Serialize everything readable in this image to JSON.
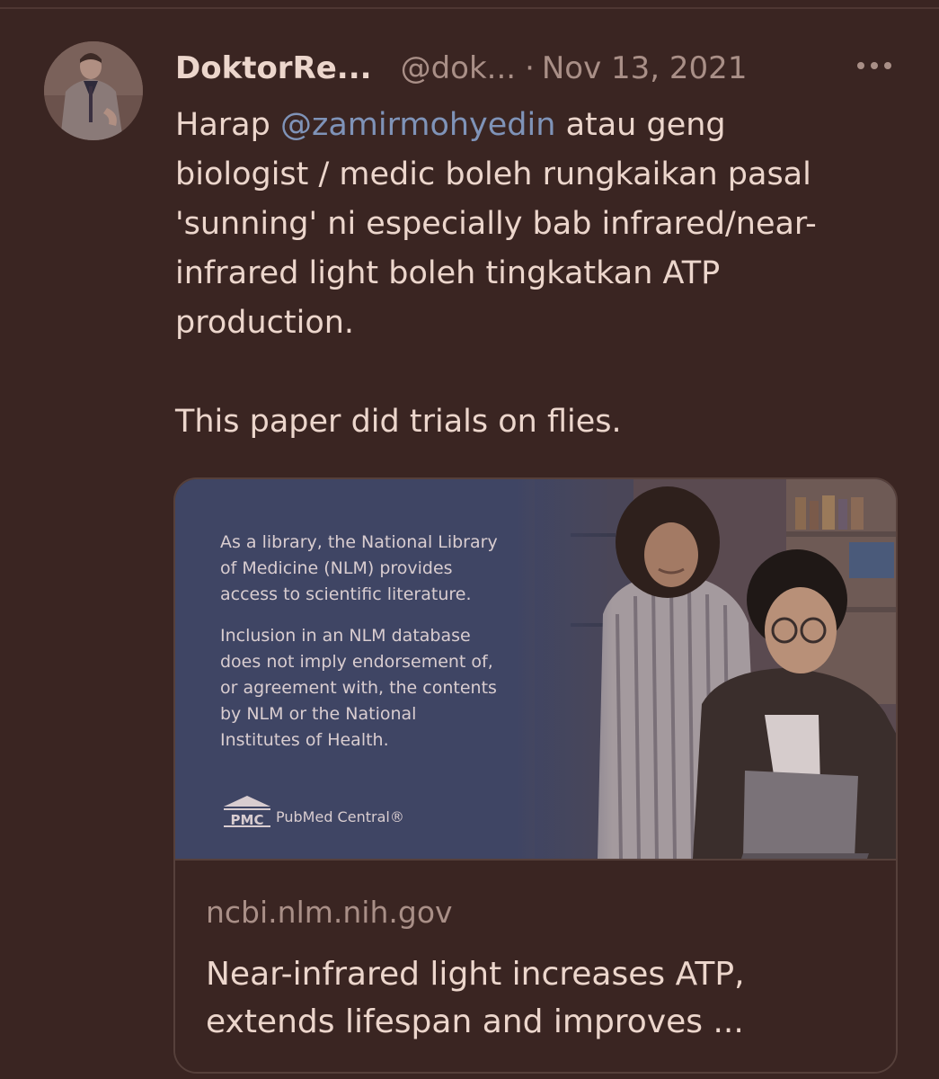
{
  "tweet": {
    "display_name": "DoktorRe...",
    "handle": "@dok...",
    "separator": "·",
    "date": "Nov 13, 2021",
    "more_icon": "more-dots-icon",
    "text_before_mention": "Harap ",
    "mention": "@zamirmohyedin",
    "text_after_mention": " atau geng\nbiologist / medic boleh rungkaikan pasal\n'sunning' ni especially bab infrared/near-\ninfrared light boleh tingkatkan ATP\nproduction.\n\nThis paper did trials on flies."
  },
  "card": {
    "media": {
      "paragraph_1": "As a library, the National Library\nof Medicine (NLM) provides\naccess to scientific literature.",
      "paragraph_2": "Inclusion in an NLM database\ndoes not imply endorsement of,\nor agreement with, the contents\nby NLM or the National\nInstitutes of Health.",
      "logo_text": "PMC",
      "logo_name": "PubMed Central®"
    },
    "domain": "ncbi.nlm.nih.gov",
    "title": "Near-infrared light increases ATP,\nextends lifespan and improves ..."
  },
  "colors": {
    "background": "#3a2522",
    "mention": "#7f93b8",
    "secondary_text": "#a98f87",
    "primary_text": "#ecd6cc",
    "media_panel": "#3f4564"
  }
}
